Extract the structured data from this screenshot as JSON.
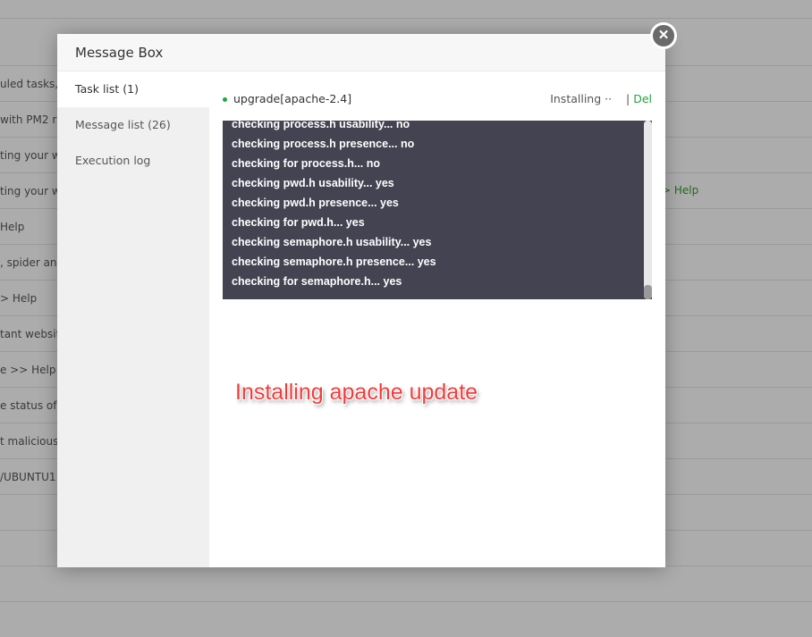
{
  "background": {
    "rows": [
      "uled tasks,",
      "with PM2 r",
      "ting your w",
      "ting your w",
      "Help",
      ", spider and",
      "> Help",
      "tant website",
      "e >> Help",
      "e status of s",
      "t malicious",
      "/UBUNTU1",
      "",
      ""
    ],
    "right_help": "> Help"
  },
  "modal": {
    "title": "Message Box",
    "tabs": [
      "Task list (1)",
      "Message list (26)",
      "Execution log"
    ],
    "task": {
      "name": "upgrade[apache-2.4]",
      "status": "Installing ··",
      "separator": "|",
      "delete": "Del"
    },
    "log": [
      "checking process.h usability... no",
      "checking process.h presence... no",
      "checking for process.h... no",
      "checking pwd.h usability... yes",
      "checking pwd.h presence... yes",
      "checking for pwd.h... yes",
      "checking semaphore.h usability... yes",
      "checking semaphore.h presence... yes",
      "checking for semaphore.h... yes"
    ],
    "close": "×"
  },
  "annotation": "Installing apache update"
}
